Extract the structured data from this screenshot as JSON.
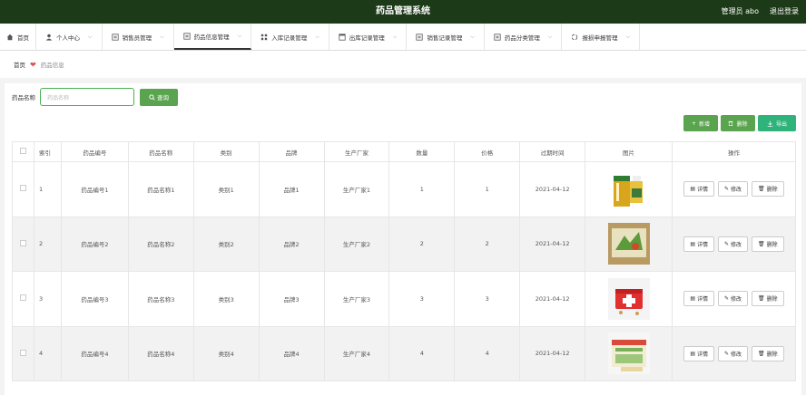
{
  "app": {
    "title": "药品管理系统",
    "user": "管理员 abo",
    "logout": "退出登录"
  },
  "nav": [
    {
      "label": "首页",
      "icon": "home-icon"
    },
    {
      "label": "个人中心",
      "icon": "user-icon"
    },
    {
      "label": "销售员管理",
      "icon": "list-icon"
    },
    {
      "label": "药品信息管理",
      "icon": "list-icon"
    },
    {
      "label": "入库记录管理",
      "icon": "grid-icon"
    },
    {
      "label": "出库记录管理",
      "icon": "window-icon"
    },
    {
      "label": "销售记录管理",
      "icon": "list-icon"
    },
    {
      "label": "药品分类管理",
      "icon": "list-icon"
    },
    {
      "label": "报损申报管理",
      "icon": "spinner-icon"
    }
  ],
  "breadcrumb": {
    "home": "首页",
    "current": "药品信息"
  },
  "search": {
    "label": "药品名称",
    "placeholder": "药品名称",
    "button": "查询"
  },
  "actions": {
    "add": "新增",
    "delete": "删除",
    "export": "导出"
  },
  "table": {
    "columns": [
      "索引",
      "药品编号",
      "药品名称",
      "类别",
      "品牌",
      "生产厂家",
      "数量",
      "价格",
      "过期时间",
      "图片",
      "操作"
    ],
    "rows": [
      {
        "index": "1",
        "code": "药品编号1",
        "name": "药品名称1",
        "category": "类别1",
        "brand": "品牌1",
        "maker": "生产厂家1",
        "qty": "1",
        "price": "1",
        "expire": "2021-04-12"
      },
      {
        "index": "2",
        "code": "药品编号2",
        "name": "药品名称2",
        "category": "类别2",
        "brand": "品牌2",
        "maker": "生产厂家2",
        "qty": "2",
        "price": "2",
        "expire": "2021-04-12"
      },
      {
        "index": "3",
        "code": "药品编号3",
        "name": "药品名称3",
        "category": "类别3",
        "brand": "品牌3",
        "maker": "生产厂家3",
        "qty": "3",
        "price": "3",
        "expire": "2021-04-12"
      },
      {
        "index": "4",
        "code": "药品编号4",
        "name": "药品名称4",
        "category": "类别4",
        "brand": "品牌4",
        "maker": "生产厂家4",
        "qty": "4",
        "price": "4",
        "expire": "2021-04-12"
      }
    ],
    "row_ops": {
      "detail": "详情",
      "edit": "修改",
      "delete": "删除"
    }
  },
  "colors": {
    "topbar": "#1d3a18",
    "primary": "#5aa34f",
    "export": "#2fb37a",
    "accent": "#d9534f"
  }
}
